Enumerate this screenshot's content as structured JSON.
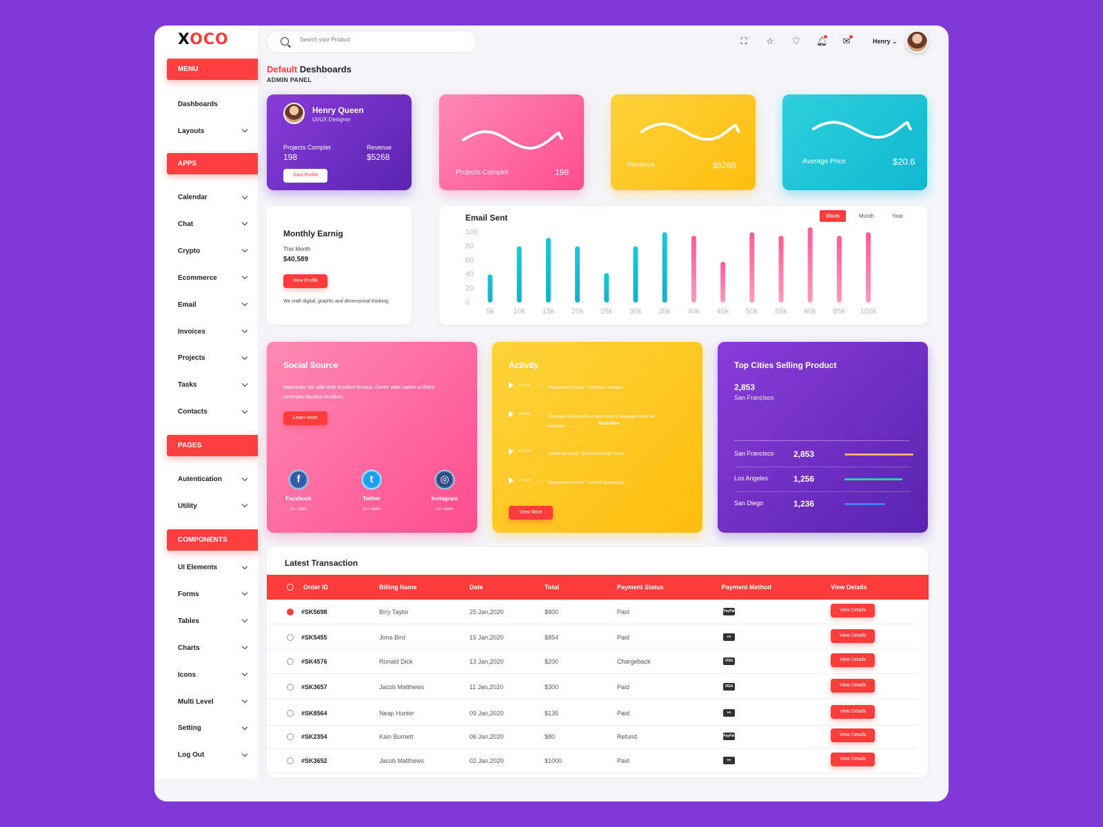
{
  "logo": {
    "part1": "X",
    "part2": "O",
    "part3": "C",
    "part4": "O"
  },
  "sidebar": {
    "sections": {
      "menu": "MENU",
      "apps": "APPS",
      "pages": "PAGES",
      "components": "COMPONENTS"
    },
    "menu_items": [
      "Dashboards",
      "Layouts"
    ],
    "app_items": [
      "Calendar",
      "Chat",
      "Crypto",
      "Ecommerce",
      "Email",
      "Invoices",
      "Projects",
      "Tasks",
      "Contacts"
    ],
    "page_items": [
      "Autentication",
      "Utility"
    ],
    "component_items": [
      "UI Elements",
      "Forms",
      "Tables",
      "Charts",
      "Icons",
      "Multi Level",
      "Setting",
      "Log Out"
    ]
  },
  "search": {
    "placeholder": "Search your Product"
  },
  "user": {
    "name": "Henry"
  },
  "page": {
    "title_accent": "Default",
    "title_rest": "Deshboards",
    "subtitle": "ADMIN PANEL"
  },
  "profile_card": {
    "name": "Henry Queen",
    "role": "UI/UX Designer",
    "projects_label": "Projects Complet",
    "projects_value": "198",
    "revenue_label": "Revenue",
    "revenue_value": "$5268",
    "button": "View Profile"
  },
  "stat_cards": [
    {
      "label": "Projects Complet",
      "value": "198"
    },
    {
      "label": "Revenue",
      "value": "$5268"
    },
    {
      "label": "Average Price",
      "value": "$20.6"
    }
  ],
  "monthly": {
    "title": "Monthly Earnig",
    "period": "This Month",
    "amount": "$40,589",
    "button": "View Profile",
    "text": "We craft digital, graphic and dimensional thinking."
  },
  "chart_tabs": [
    "Week",
    "Month",
    "Year"
  ],
  "chart_data": {
    "type": "bar",
    "title": "Email Sent",
    "categories": [
      "5k",
      "10k",
      "15k",
      "20k",
      "25k",
      "30k",
      "35k",
      "40k",
      "45k",
      "50k",
      "55k",
      "60k",
      "65k",
      "100k"
    ],
    "series": [
      {
        "values": [
          40,
          80,
          92,
          80,
          42,
          80,
          100,
          95,
          58,
          100,
          95,
          107,
          95,
          100
        ]
      }
    ],
    "yticks": [
      "100",
      "80",
      "60",
      "40",
      "20",
      "0"
    ],
    "ylim": [
      0,
      100
    ],
    "colors": [
      "#19c0d4",
      "#19c0d4",
      "#19c0d4",
      "#19c0d4",
      "#19c0d4",
      "#19c0d4",
      "#19c0d4",
      "#ff4d8d",
      "#ff4d8d",
      "#ff4d8d",
      "#ff4d8d",
      "#ff4d8d",
      "#ff4d8d",
      "#ff4d8d"
    ]
  },
  "social": {
    "title": "Social Source",
    "text": "Maecenas nec odio ante tincidunt tempus. Donec vitae sapien ut libero venenatis faucibus tincidunt.",
    "button": "Learn more",
    "items": [
      {
        "name": "Facebook",
        "sales": "257 sales",
        "icon": "f"
      },
      {
        "name": "Twitter",
        "sales": "257 sales",
        "icon": "t"
      },
      {
        "name": "Instagram",
        "sales": "257 sales",
        "icon": "◎"
      }
    ]
  },
  "activity": {
    "title": "Activity",
    "items": [
      {
        "date": "12 Jun",
        "text": "Responded to need \" Volunteer Activities\"",
        "more": ""
      },
      {
        "date": "16 Jun",
        "text": "Everyone realizes why a new common language would be desirable.",
        "more": "Read More"
      },
      {
        "date": "19 Jun",
        "text": "Joined the group \" Boardsmanship Forum\"",
        "more": ""
      },
      {
        "date": "19 Jun",
        "text": "Responded to need \" In-Kind Opportunity\"",
        "more": ""
      }
    ],
    "button": "View More"
  },
  "cities": {
    "title": "Top Cities Selling Product",
    "top_value": "2,853",
    "top_city": "San Francisco",
    "rows": [
      {
        "city": "San Francisco",
        "value": "2,853",
        "bar": 1.0,
        "color": "#f4b35a"
      },
      {
        "city": "Los Angeles",
        "value": "1,256",
        "bar": 0.84,
        "color": "#2ed3a0"
      },
      {
        "city": "San Diego",
        "value": "1,236",
        "bar": 0.59,
        "color": "#4a7cff"
      }
    ]
  },
  "transactions": {
    "title": "Latest Transaction",
    "headers": [
      "Order ID",
      "Billing Name",
      "Date",
      "Total",
      "Payment Status",
      "Payment Method",
      "View Details"
    ],
    "button": "View Details",
    "rows": [
      {
        "id": "#SK5698",
        "name": "Brry Taylor",
        "date": "25 Jan,2020",
        "total": "$800",
        "status": "Paid",
        "method": "paypal",
        "method_label": "PayPal"
      },
      {
        "id": "#SK5455",
        "name": "Jona Bird",
        "date": "15 Jan,2020",
        "total": "$854",
        "status": "Paid",
        "method": "mastercard",
        "method_label": "●●"
      },
      {
        "id": "#SK4576",
        "name": "Ronald Dick",
        "date": "13 Jan,2020",
        "total": "$200",
        "status": "Chargeback",
        "method": "visa",
        "method_label": "VISA"
      },
      {
        "id": "#SK3657",
        "name": "Jacob  Matthews",
        "date": "11 Jan,2020",
        "total": "$300",
        "status": "Paid",
        "method": "visa",
        "method_label": "VISA"
      },
      {
        "id": "#SK8564",
        "name": "Neap Hunter",
        "date": "09 Jan,2020",
        "total": "$135",
        "status": "Paid",
        "method": "mastercard",
        "method_label": "●●"
      },
      {
        "id": "#SK2354",
        "name": "Kain Burnett",
        "date": "06 Jan,2020",
        "total": "$80",
        "status": "Refund",
        "method": "paypal",
        "method_label": "PayPal"
      },
      {
        "id": "#SK3652",
        "name": "Jacob  Matthews",
        "date": "02 Jan,2020",
        "total": "$1000",
        "status": "Paid",
        "method": "mastercard",
        "method_label": "●●"
      }
    ]
  }
}
